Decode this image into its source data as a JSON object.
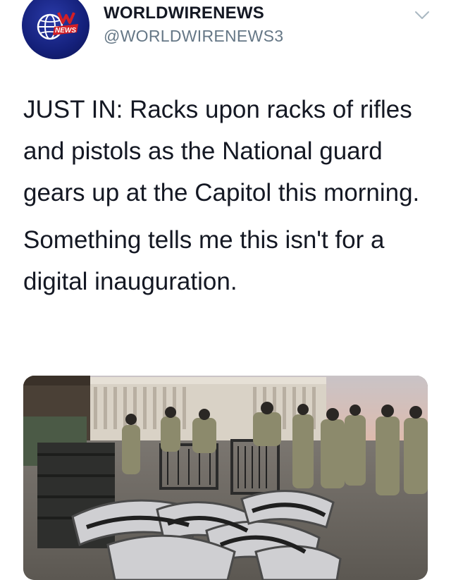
{
  "tweet": {
    "author": {
      "display_name": "WORLDWIRENEWS",
      "handle": "@WORLDWIRENEWS3",
      "avatar_logo_text": "NEWS"
    },
    "menu_icon": "chevron-down-icon",
    "text_paragraphs": [
      "JUST IN: Racks upon racks of rifles and pistols as the National guard gears up at the Capitol this morning.",
      "Something tells me this isn't for a digital inauguration."
    ],
    "media": {
      "type": "photo",
      "content": "national-guard-at-capitol-photo"
    }
  },
  "colors": {
    "text": "#141823",
    "secondary_text": "#657786",
    "avatar_bg": "#14207a",
    "logo_red": "#d21f26"
  }
}
